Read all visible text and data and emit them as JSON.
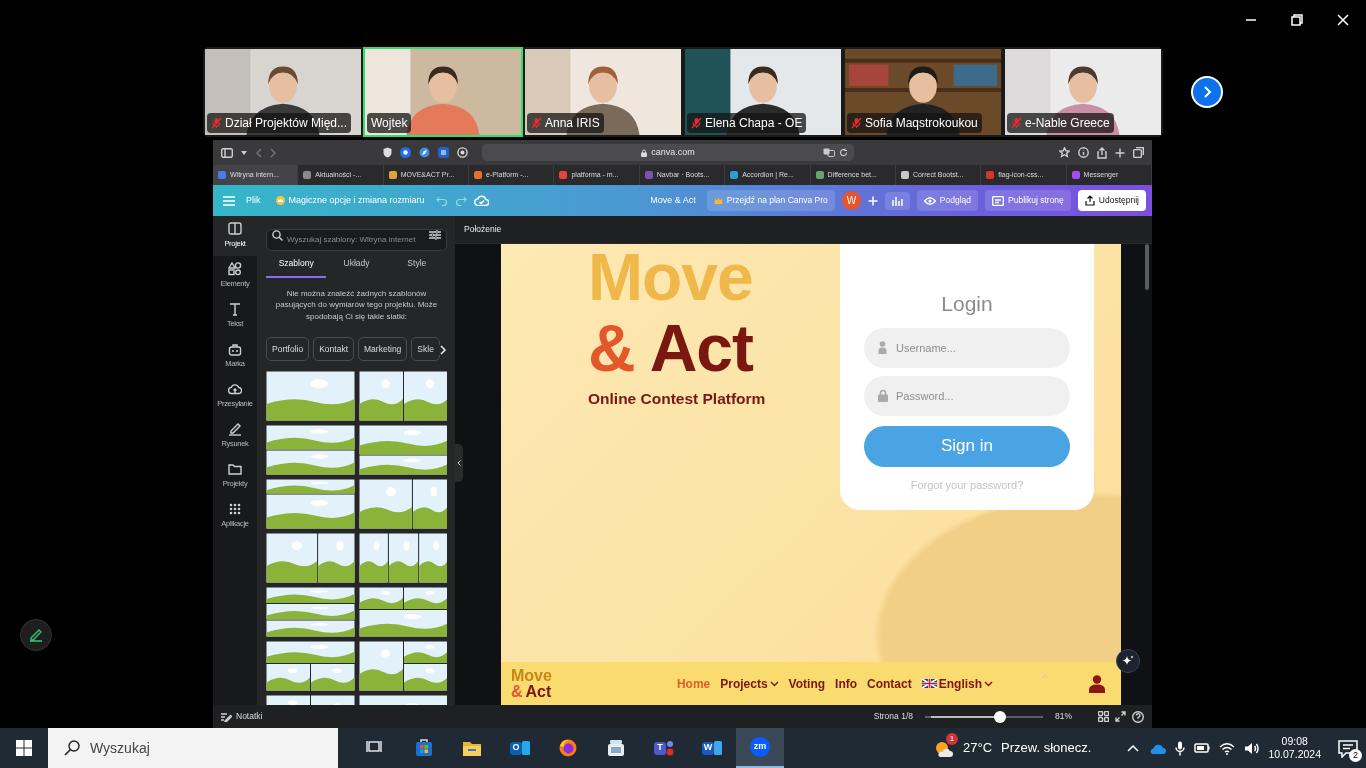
{
  "participants": [
    {
      "name": "Dział Projektów Międ...",
      "muted": true,
      "speaking": false
    },
    {
      "name": "Wojtek",
      "muted": false,
      "speaking": true
    },
    {
      "name": "Anna IRIS",
      "muted": true,
      "speaking": false
    },
    {
      "name": "Elena Chapa - OE",
      "muted": true,
      "speaking": false
    },
    {
      "name": "Sofia Maqstrokoukou",
      "muted": true,
      "speaking": false
    },
    {
      "name": "e-Nable Greece",
      "muted": true,
      "speaking": false
    }
  ],
  "browser": {
    "address": "canva.com",
    "tabs": [
      {
        "label": "Witryna intern...",
        "selected": true,
        "color": "#4b7bec"
      },
      {
        "label": "Aktualności -...",
        "selected": false,
        "color": "#8a8a8a"
      },
      {
        "label": "MOVE&ACT Pr...",
        "selected": false,
        "color": "#e3a33a"
      },
      {
        "label": "e-Platform -...",
        "selected": false,
        "color": "#e8702a"
      },
      {
        "label": "platforma - m...",
        "selected": false,
        "color": "#ea4335"
      },
      {
        "label": "Navbar · Boots...",
        "selected": false,
        "color": "#7952b3"
      },
      {
        "label": "Accordion | Re...",
        "selected": false,
        "color": "#2a9fd6"
      },
      {
        "label": "Difference bet...",
        "selected": false,
        "color": "#6aa36f"
      },
      {
        "label": "Correct Bootst...",
        "selected": false,
        "color": "#c8c8c8"
      },
      {
        "label": "flag-icon-css...",
        "selected": false,
        "color": "#d9342b"
      },
      {
        "label": "Messenger",
        "selected": false,
        "color": "#a34bf5"
      }
    ]
  },
  "canva": {
    "toolbar": {
      "file_menu": "Plik",
      "magic": "Magiczne opcje i zmiana rozmiaru",
      "design_title": "Move & Act",
      "upgrade": "Przejdź na plan Canva Pro",
      "avatar": "W",
      "preview": "Podgląd",
      "publish": "Publikuj stronę",
      "share": "Udostępnij"
    },
    "side_nav": [
      {
        "label": "Projekt",
        "selected": true
      },
      {
        "label": "Elementy",
        "selected": false
      },
      {
        "label": "Tekst",
        "selected": false
      },
      {
        "label": "Marka",
        "selected": false
      },
      {
        "label": "Przesyłanie",
        "selected": false
      },
      {
        "label": "Rysunek",
        "selected": false
      },
      {
        "label": "Projekty",
        "selected": false
      },
      {
        "label": "Aplikacje",
        "selected": false
      }
    ],
    "panel": {
      "search_placeholder": "Wyszukaj szablony: Witryna internet",
      "tabs": [
        {
          "label": "Szablony",
          "selected": true
        },
        {
          "label": "Układy",
          "selected": false
        },
        {
          "label": "Style",
          "selected": false
        }
      ],
      "message": "Nie można znaleźć żadnych szablonów pasujących do wymiarów tego projektu. Może spodobają Ci się takie siatki:",
      "chips": [
        "Portfolio",
        "Kontakt",
        "Marketing",
        "Skle"
      ]
    },
    "canvas": {
      "header": "Położenie",
      "page": {
        "logo": [
          "Move",
          "&",
          "Act"
        ],
        "tagline": "Online Contest Platform",
        "login": {
          "title": "Login",
          "username_placeholder": "Username...",
          "password_placeholder": "Password...",
          "button": "Sign in",
          "forgot": "Forgot your password?"
        },
        "footer": {
          "logo": [
            "Move",
            "&",
            "Act"
          ],
          "nav": [
            {
              "label": "Home",
              "kind": "link",
              "selected": true,
              "dropdown": false
            },
            {
              "label": "Projects",
              "kind": "link",
              "selected": false,
              "dropdown": true
            },
            {
              "label": "Voting",
              "kind": "link",
              "selected": false,
              "dropdown": false
            },
            {
              "label": "Info",
              "kind": "link",
              "selected": false,
              "dropdown": false
            },
            {
              "label": "Contact",
              "kind": "link",
              "selected": false,
              "dropdown": false
            },
            {
              "label": "English",
              "kind": "language",
              "selected": false,
              "dropdown": true
            }
          ]
        }
      }
    },
    "bottom_bar": {
      "notes": "Notatki",
      "page": "Strona 1/8",
      "zoom": {
        "level": 0.65,
        "reading": "81%"
      }
    }
  },
  "taskbar": {
    "search_placeholder": "Wyszukaj",
    "apps": [
      {
        "kind": "task-view",
        "selected": false
      },
      {
        "kind": "store",
        "selected": false
      },
      {
        "kind": "explorer",
        "selected": false
      },
      {
        "kind": "outlook",
        "label": "O",
        "selected": false
      },
      {
        "kind": "firefox",
        "selected": false
      },
      {
        "kind": "app",
        "selected": false
      },
      {
        "kind": "teams",
        "label": "T",
        "selected": false
      },
      {
        "kind": "word",
        "label": "W",
        "selected": false
      },
      {
        "kind": "zoom",
        "label": "zm",
        "selected": true
      }
    ],
    "weather_badge": "1",
    "temperature": "27°C",
    "weather": "Przew. słonecz.",
    "time": "09:08",
    "date": "10.07.2024",
    "notifications": "2"
  }
}
